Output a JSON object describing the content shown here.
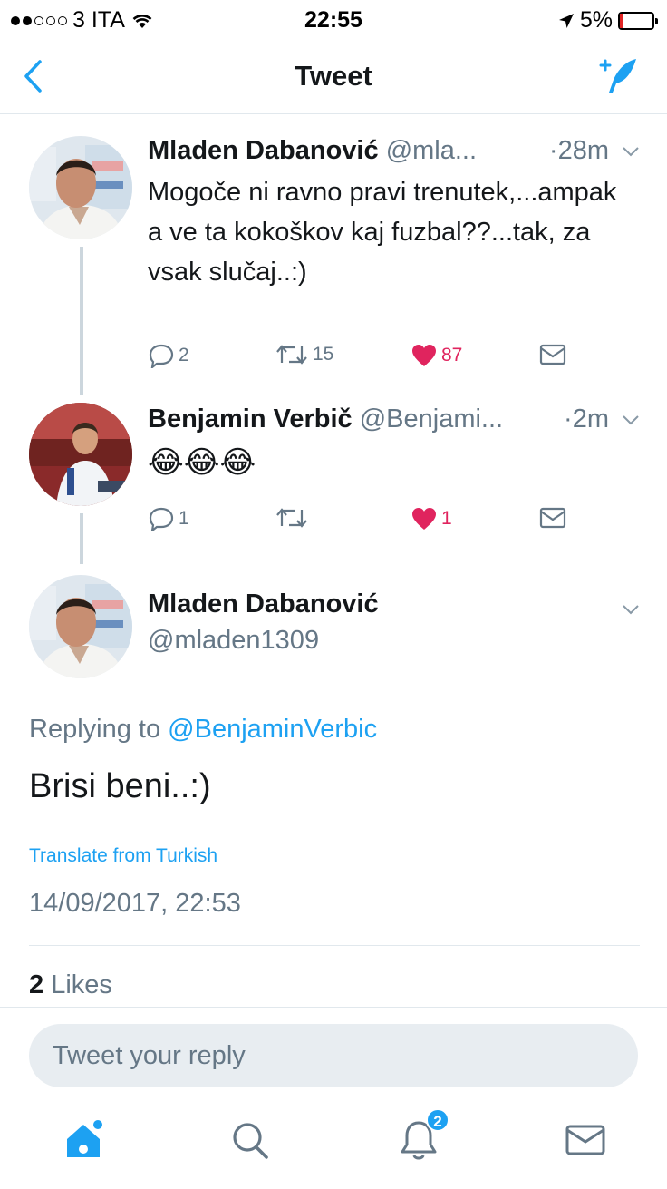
{
  "status_bar": {
    "carrier": "3 ITA",
    "time": "22:55",
    "battery": "5%"
  },
  "nav": {
    "title": "Tweet"
  },
  "thread": [
    {
      "name": "Mladen Dabanović",
      "handle": "@mla...",
      "time": "·28m",
      "text": "Mogoče ni ravno pravi trenutek,...ampak a ve ta kokoškov kaj fuzbal??...tak, za vsak slučaj..:)",
      "replies": "2",
      "retweets": "15",
      "likes": "87"
    },
    {
      "name": "Benjamin Verbič",
      "handle": "@Benjami...",
      "time": "·2m",
      "text": "😂😂😂",
      "replies": "1",
      "retweets": "",
      "likes": "1"
    }
  ],
  "focus_tweet": {
    "name": "Mladen Dabanović",
    "handle": "@mladen1309",
    "replying_prefix": "Replying to",
    "replying_to": "@BenjaminVerbic",
    "text": "Brisi beni..:)",
    "translate": "Translate from Turkish",
    "datetime": "14/09/2017, 22:53",
    "likes_count": "2",
    "likes_label": "Likes"
  },
  "reply": {
    "placeholder": "Tweet your reply"
  },
  "tabbar": {
    "notifications_badge": "2"
  },
  "colors": {
    "accent": "#1da1f2",
    "like": "#e0245e",
    "secondary_text": "#657786"
  }
}
